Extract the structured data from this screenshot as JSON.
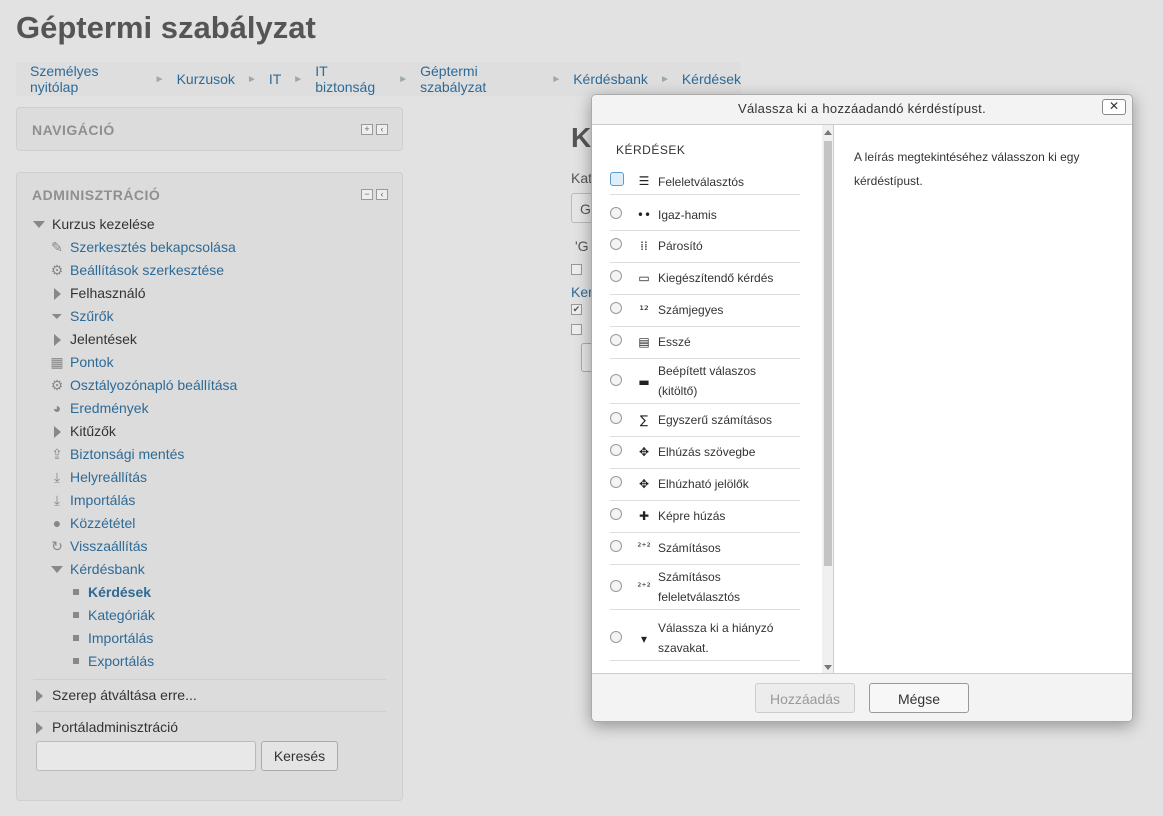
{
  "page": {
    "title": "Géptermi szabályzat"
  },
  "breadcrumb": [
    "Személyes nyitólap",
    "Kurzusok",
    "IT",
    "IT biztonság",
    "Géptermi szabályzat",
    "Kérdésbank",
    "Kérdések"
  ],
  "navigation": {
    "title": "NAVIGÁCIÓ"
  },
  "admin": {
    "title": "ADMINISZTRÁCIÓ",
    "course_admin": "Kurzus kezelése",
    "items": {
      "edit_on": "Szerkesztés bekapcsolása",
      "settings": "Beállítások szerkesztése",
      "users": "Felhasználó",
      "filters": "Szűrők",
      "reports": "Jelentések",
      "grades": "Pontok",
      "gradebook": "Osztályozónapló beállítása",
      "outcomes": "Eredmények",
      "badges": "Kitűzők",
      "backup": "Biztonsági mentés",
      "restore": "Helyreállítás",
      "import": "Importálás",
      "publish": "Közzététel",
      "reset": "Visszaállítás",
      "qbank": "Kérdésbank",
      "questions": "Kérdések",
      "categories": "Kategóriák",
      "qimport": "Importálás",
      "qexport": "Exportálás"
    },
    "switch_role": "Szerep átváltása erre...",
    "site_admin": "Portáladminisztráció",
    "search_button": "Keresés",
    "search_value": ""
  },
  "background_main": {
    "heading_fragment": "K",
    "label1": "Kat",
    "field": "G",
    "quote": "'G",
    "link": "Ker"
  },
  "dialog": {
    "title": "Válassza ki a hozzáadandó kérdéstípust.",
    "close_label": "✕",
    "section_heading": "KÉRDÉSEK",
    "description": "A leírás megtekintéséhez válasszon ki egy kérdéstípust.",
    "add_button": "Hozzáadás",
    "cancel_button": "Mégse",
    "options": [
      {
        "label": "Feleletválasztós",
        "icon": "multichoice-icon",
        "glyph": "☰"
      },
      {
        "label": "Igaz-hamis",
        "icon": "truefalse-icon",
        "glyph": "••"
      },
      {
        "label": "Párosító",
        "icon": "matching-icon",
        "glyph": "⁞⁞"
      },
      {
        "label": "Kiegészítendő kérdés",
        "icon": "shortanswer-icon",
        "glyph": "▭"
      },
      {
        "label": "Számjegyes",
        "icon": "numerical-icon",
        "glyph": "¹²"
      },
      {
        "label": "Esszé",
        "icon": "essay-icon",
        "glyph": "▤"
      },
      {
        "label": "Beépített válaszos (kitöltő)",
        "icon": "cloze-icon",
        "glyph": "▬"
      },
      {
        "label": "Egyszerű számításos",
        "icon": "calculatedsimple-icon",
        "glyph": "∑"
      },
      {
        "label": "Elhúzás szövegbe",
        "icon": "ddwtos-icon",
        "glyph": "✥"
      },
      {
        "label": "Elhúzható jelölők",
        "icon": "ddmarker-icon",
        "glyph": "✥"
      },
      {
        "label": "Képre húzás",
        "icon": "ddimageortext-icon",
        "glyph": "✚"
      },
      {
        "label": "Számításos",
        "icon": "calculated-icon",
        "glyph": "²⁺²"
      },
      {
        "label": "Számításos feleletválasztós",
        "icon": "calculatedmulti-icon",
        "glyph": "²⁺²"
      },
      {
        "label": "Válassza ki a hiányzó szavakat.",
        "icon": "gapselect-icon",
        "glyph": "▾"
      }
    ]
  }
}
